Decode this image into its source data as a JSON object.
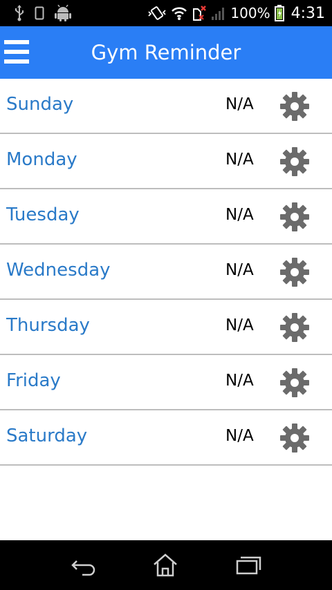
{
  "status_bar": {
    "battery_percent": "100%",
    "time": "4:31",
    "icons": [
      "usb-icon",
      "phone-outline-icon",
      "android-icon",
      "vibrate-icon",
      "wifi-icon",
      "sim-no-signal-icon",
      "signal-icon",
      "battery-charging-icon"
    ]
  },
  "app_bar": {
    "title": "Gym Reminder",
    "menu_icon": "hamburger-menu-icon",
    "color": "#2a7ef5"
  },
  "days": [
    {
      "name": "Sunday",
      "value": "N/A"
    },
    {
      "name": "Monday",
      "value": "N/A"
    },
    {
      "name": "Tuesday",
      "value": "N/A"
    },
    {
      "name": "Wednesday",
      "value": "N/A"
    },
    {
      "name": "Thursday",
      "value": "N/A"
    },
    {
      "name": "Friday",
      "value": "N/A"
    },
    {
      "name": "Saturday",
      "value": "N/A"
    }
  ],
  "row_icon": "gear-icon",
  "nav_bar": {
    "icons": [
      "back-icon",
      "home-icon",
      "recent-apps-icon"
    ]
  }
}
